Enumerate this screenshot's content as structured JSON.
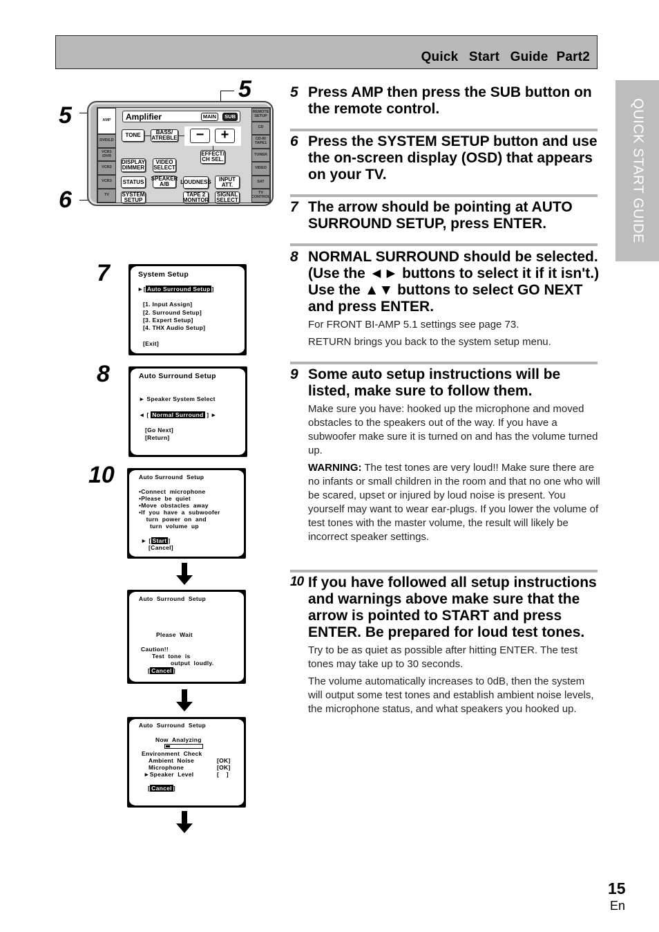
{
  "header": {
    "title": "Quick Start Guide",
    "part": "Part2"
  },
  "side_tab": {
    "label": "QUICK START GUIDE"
  },
  "figure_labels": {
    "remote_amp": "5",
    "remote_sub": "5",
    "remote_setup": "6",
    "osd_system_setup": "7",
    "osd_auto_surround": "8",
    "osd_instructions": "10"
  },
  "remote": {
    "display_title": "Amplifier",
    "mode_main": "MAIN",
    "mode_sub": "SUB",
    "left_column": [
      "AMP",
      "DVD/LD",
      "VCR1\n/DVR",
      "VCR2",
      "VCR3",
      "TV"
    ],
    "right_column": [
      "REMOTE\nSETUP",
      "CD",
      "CD-R/\nTAPE1",
      "TUNER",
      "VIDEO",
      "SAT",
      "TV\nCONTROL"
    ],
    "buttons": {
      "tone": "TONE",
      "bass_treble": "BASS/\nATREBLE",
      "minus": "−",
      "plus": "+",
      "effect": "EFFECT/\nCH SEL.",
      "display_dimmer": "DISPLAY\nDIMMER",
      "video_select": "VIDEO\nSELECT",
      "status": "STATUS",
      "speaker_ab": "SPEAKER\nA/B",
      "loudness": "LOUDNESS",
      "input_att": "INPUT\nATT.",
      "system_setup": "SYSTEM\nSETUP",
      "tape2_monitor": "TAPE 2\nMONITOR",
      "signal_select": "SIGNAL\nSELECT"
    }
  },
  "osd_screens": {
    "system_setup": {
      "title": "System Setup",
      "arrow": "►[",
      "selected": "Auto Surround Setup",
      "close": "]",
      "items": [
        "[1. Input Assign]",
        "[2. Surround Setup]",
        "[3. Expert Setup]",
        "[4. THX Audio Setup]"
      ],
      "exit": "[Exit]"
    },
    "auto_surround": {
      "title": "Auto Surround Setup",
      "speaker_select": "► Speaker System Select",
      "left_arrow": "◄ [",
      "selected": "Normal Surround",
      "right_arrow": "] ►",
      "go_next": "[Go Next]",
      "return": "[Return]"
    },
    "instructions": {
      "title": "Auto Surround  Setup",
      "lines": [
        "•Connect  microphone",
        "•Please  be  quiet",
        "•Move  obstacles  away",
        "•If  you  have  a  subwoofer",
        "    turn  power  on  and",
        "      turn  volume  up"
      ],
      "arrow": "►",
      "start": "Start",
      "cancel": "[Cancel]"
    },
    "please_wait": {
      "title": "Auto  Surround  Setup",
      "wait": "Please  Wait",
      "caution": "Caution!!",
      "line1": "Test  tone  is",
      "line2": "output  loudly.",
      "cancel": "Cancel"
    },
    "analyzing": {
      "title": "Auto  Surround  Setup",
      "status": "Now  Analyzing",
      "progress": 0.12,
      "env_check": "Environment  Check",
      "rows": [
        {
          "label": "Ambient  Noise",
          "value": "[OK]"
        },
        {
          "label": "Microphone",
          "value": "[OK]"
        },
        {
          "label": "►Speaker  Level",
          "value": "[    ]"
        }
      ],
      "cancel": "Cancel"
    }
  },
  "steps": [
    {
      "num": "5",
      "heading": "Press AMP then press the SUB button on the remote control.",
      "body": []
    },
    {
      "num": "6",
      "heading": "Press the SYSTEM SETUP button and use the on-screen display (OSD) that appears on your TV.",
      "body": []
    },
    {
      "num": "7",
      "heading": "The arrow should be pointing at AUTO SURROUND SETUP, press ENTER.",
      "body": []
    },
    {
      "num": "8",
      "heading": "NORMAL SURROUND should be selected. (Use the ◄► buttons to select it if it isn't.) Use the ▲▼ buttons to select GO NEXT and press ENTER.",
      "body": [
        "For FRONT BI-AMP 5.1 settings see page 73.",
        "RETURN brings you back to the system setup menu."
      ]
    },
    {
      "num": "9",
      "heading": "Some auto setup instructions will be listed, make sure to follow them.",
      "body": [
        "Make sure you have: hooked up the microphone and moved obstacles to the speakers out of the way. If you have a subwoofer make sure it is turned on and has the volume turned up."
      ],
      "warning_label": "WARNING:",
      "warning_text": " The test tones are very loud!! Make sure there are no infants or small children in the room and that no one who will be scared, upset or injured by loud noise is present. You yourself may want to wear ear-plugs. If you lower the volume of test tones with the master volume, the result will likely be incorrect speaker settings."
    },
    {
      "num": "10",
      "heading": "If you have followed all setup instructions and warnings above make sure that the arrow is pointed to START and press ENTER. Be prepared for loud test tones.",
      "body": [
        "Try to be as quiet as possible after hitting ENTER. The test tones may take up to 30 seconds.",
        "The volume automatically increases to 0dB, then the system will output some test tones and establish ambient noise levels, the microphone status, and what speakers you hooked up."
      ]
    }
  ],
  "footer": {
    "page_number": "15",
    "language": "En"
  }
}
